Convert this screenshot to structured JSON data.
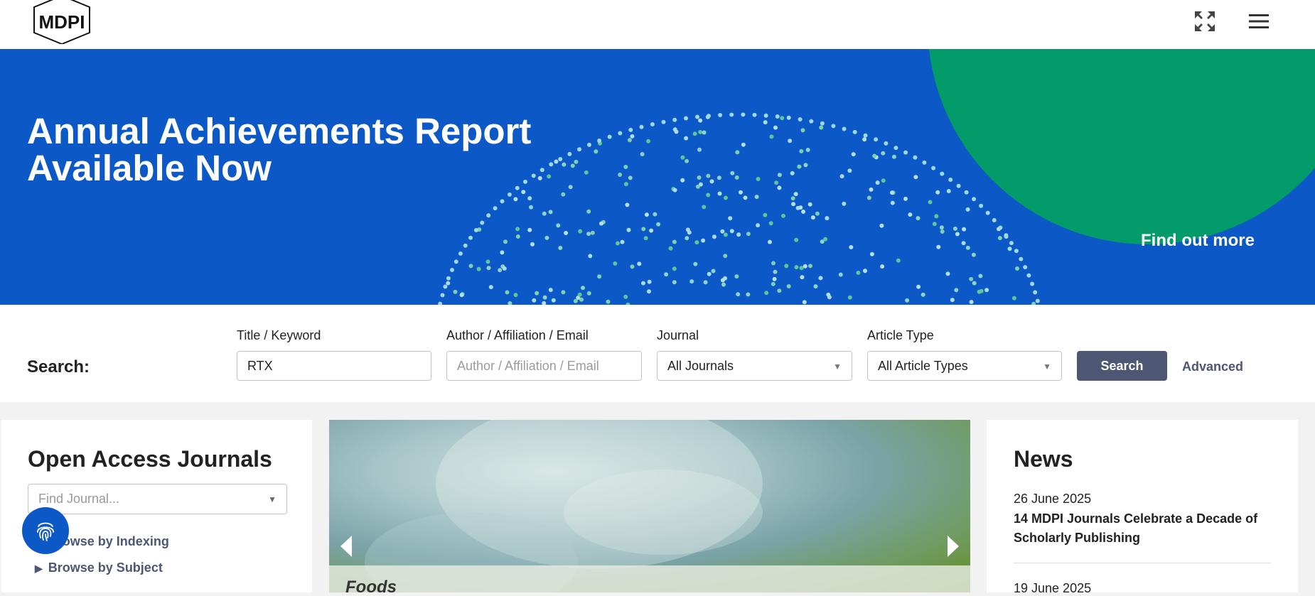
{
  "header": {
    "logo_text": "MDPI",
    "fullscreen_icon": "expand-icon",
    "menu_icon": "hamburger-menu-icon"
  },
  "banner": {
    "title_line1": "Annual Achievements Report",
    "title_line2": "Available Now",
    "link": "Find out more",
    "bg_color": "#0b58c6",
    "accent_color": "#049b6a"
  },
  "search": {
    "label": "Search:",
    "title_keyword": {
      "label": "Title / Keyword",
      "value": "RTX"
    },
    "author": {
      "label": "Author / Affiliation / Email",
      "placeholder": "Author / Affiliation / Email"
    },
    "journal": {
      "label": "Journal",
      "selected": "All Journals"
    },
    "article_type": {
      "label": "Article Type",
      "selected": "All Article Types"
    },
    "button": "Search",
    "advanced": "Advanced"
  },
  "journals": {
    "title": "Open Access Journals",
    "find_placeholder": "Find Journal...",
    "browse_indexing": "Browse by Indexing",
    "browse_subject": "Browse by Subject"
  },
  "carousel": {
    "caption": "Foods"
  },
  "news": {
    "title": "News",
    "items": [
      {
        "date": "26 June 2025",
        "headline": "14 MDPI Journals Celebrate a Decade of Scholarly Publishing"
      },
      {
        "date": "19 June 2025"
      }
    ]
  },
  "floating_button": {
    "icon": "fingerprint-icon"
  }
}
